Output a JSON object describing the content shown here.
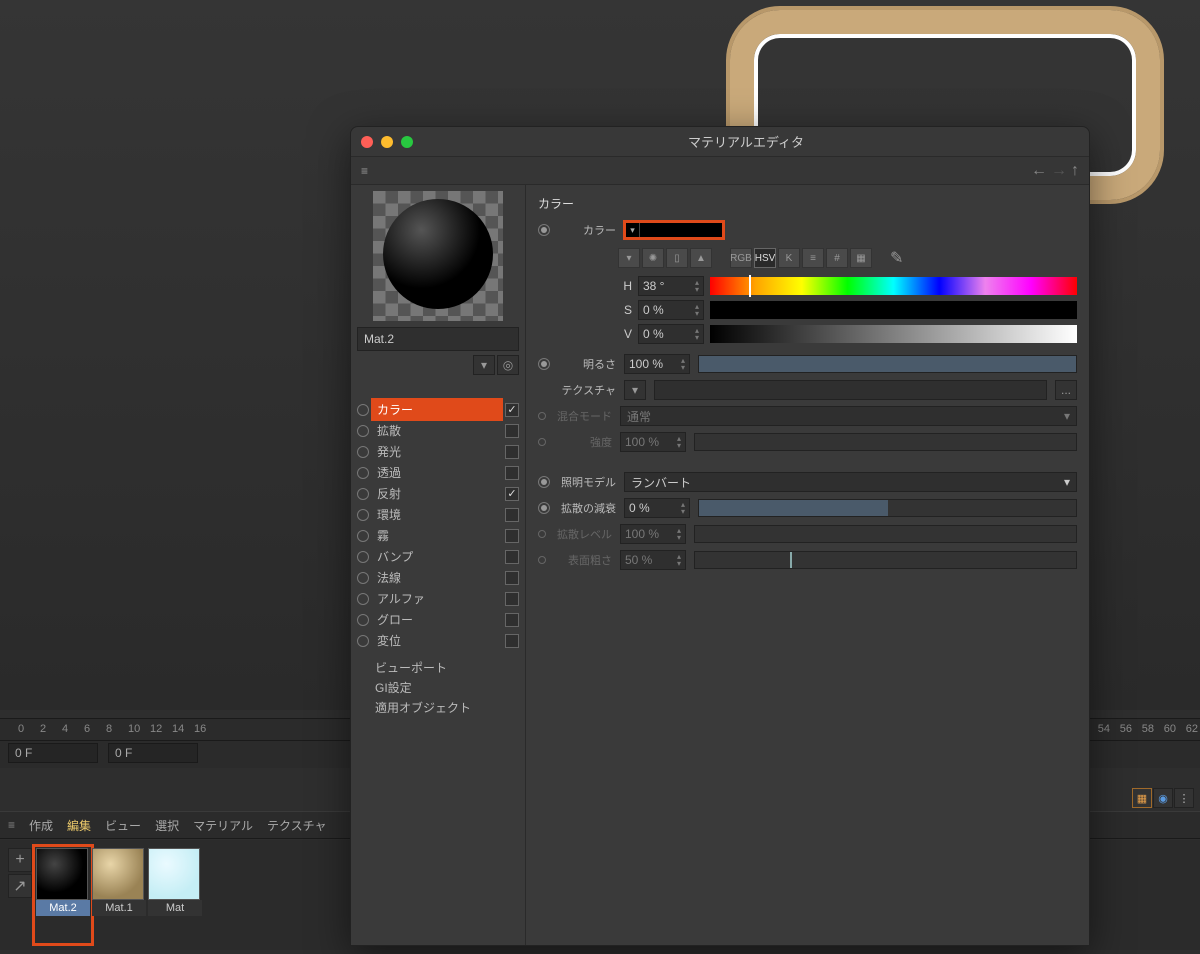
{
  "editor": {
    "title": "マテリアルエディタ",
    "material_name": "Mat.2",
    "channels": [
      {
        "label": "カラー",
        "checked": true,
        "highlighted": true
      },
      {
        "label": "拡散",
        "checked": false
      },
      {
        "label": "発光",
        "checked": false
      },
      {
        "label": "透過",
        "checked": false
      },
      {
        "label": "反射",
        "checked": true
      },
      {
        "label": "環境",
        "checked": false
      },
      {
        "label": "霧",
        "checked": false
      },
      {
        "label": "バンプ",
        "checked": false
      },
      {
        "label": "法線",
        "checked": false
      },
      {
        "label": "アルファ",
        "checked": false
      },
      {
        "label": "グロー",
        "checked": false
      },
      {
        "label": "変位",
        "checked": false
      }
    ],
    "extra": [
      "ビューポート",
      "GI設定",
      "適用オブジェクト"
    ]
  },
  "color_panel": {
    "heading": "カラー",
    "color_label": "カラー",
    "hsv": {
      "h_label": "H",
      "h": "38 °",
      "s_label": "S",
      "s": "0 %",
      "v_label": "V",
      "v": "0 %"
    },
    "brightness_label": "明るさ",
    "brightness": "100 %",
    "texture_label": "テクスチャ",
    "texture_btn": "...",
    "blend_label": "混合モード",
    "blend_value": "通常",
    "intensity_label": "強度",
    "intensity": "100 %",
    "lighting_label": "照明モデル",
    "lighting_value": "ランバート",
    "falloff_label": "拡散の減衰",
    "falloff": "0 %",
    "diffuse_level_label": "拡散レベル",
    "diffuse_level": "100 %",
    "roughness_label": "表面粗さ",
    "roughness": "50 %",
    "modes": {
      "rgb": "RGB",
      "hsv": "HSV",
      "k": "K"
    }
  },
  "timeline": {
    "ticks": [
      0,
      2,
      4,
      6,
      8,
      10,
      12,
      14,
      16
    ],
    "ticks_right": [
      54,
      56,
      58,
      60,
      62
    ],
    "frame_left": "0 F",
    "frame_field": "0 F"
  },
  "material_bar": {
    "items": [
      "作成",
      "編集",
      "ビュー",
      "選択",
      "マテリアル",
      "テクスチャ"
    ],
    "active_index": 1
  },
  "materials": [
    {
      "name": "Mat.2",
      "selected": true,
      "style": "black"
    },
    {
      "name": "Mat.1",
      "selected": false,
      "style": "tan"
    },
    {
      "name": "Mat",
      "selected": false,
      "style": "blue"
    }
  ]
}
